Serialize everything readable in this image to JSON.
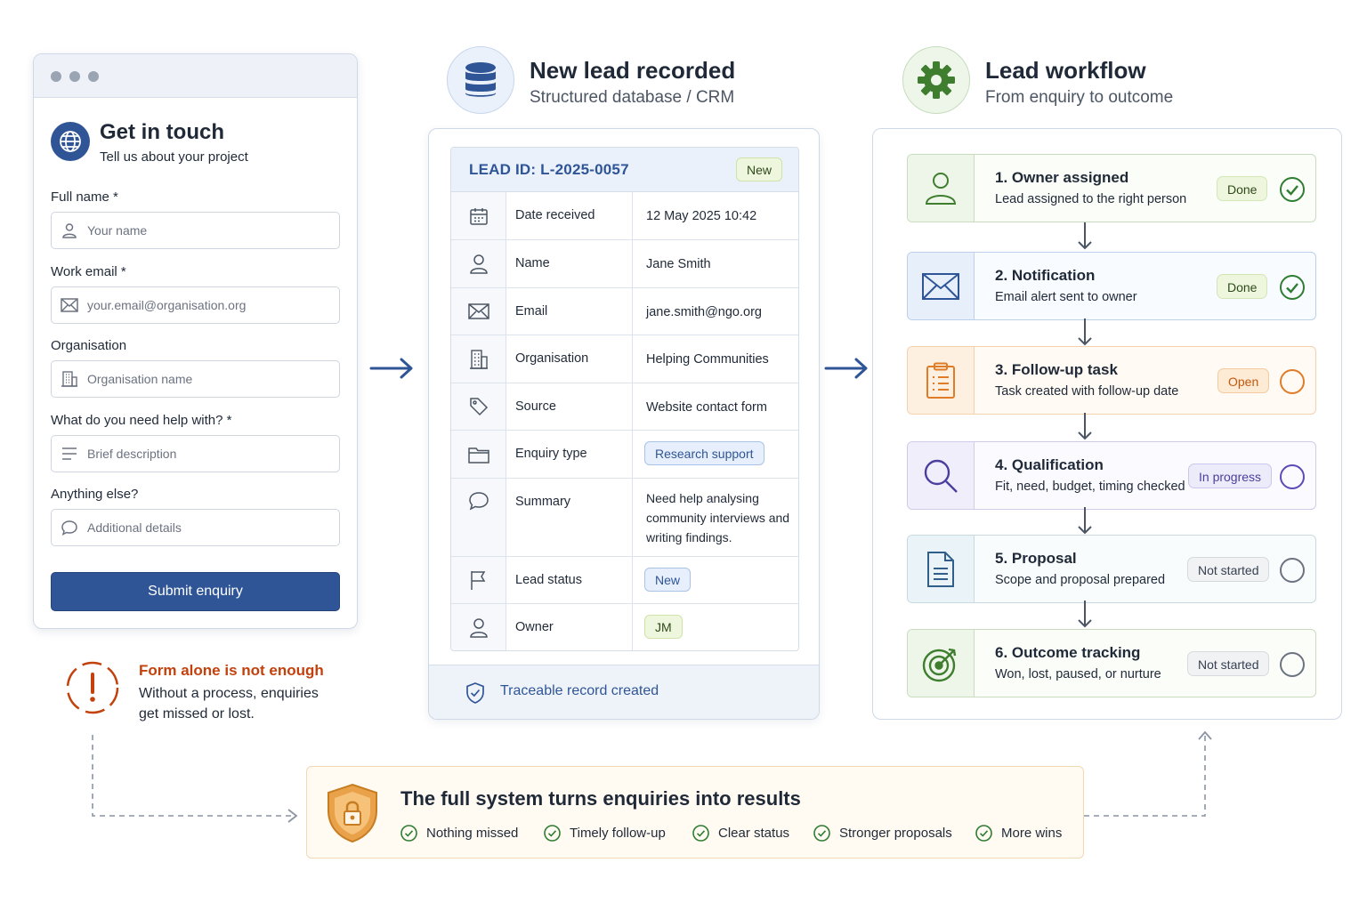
{
  "form": {
    "title": "Get in touch",
    "subtitle": "Tell us about your project",
    "fields": [
      {
        "label": "Full name *",
        "placeholder": "Your name",
        "icon": "user-icon"
      },
      {
        "label": "Work email *",
        "placeholder": "your.email@organisation.org",
        "icon": "envelope-icon"
      },
      {
        "label": "Organisation",
        "placeholder": "Organisation name",
        "icon": "building-icon"
      },
      {
        "label": "What do you need help with? *",
        "placeholder": "Brief description",
        "icon": "lines-icon"
      },
      {
        "label": "Anything else?",
        "placeholder": "Additional details",
        "icon": "chat-bubble-icon"
      }
    ],
    "submit_label": "Submit enquiry"
  },
  "warning": {
    "title": "Form alone is not enough",
    "text": "Without a process, enquiries get missed or lost."
  },
  "database": {
    "header_title": "New lead recorded",
    "header_subtitle": "Structured database / CRM",
    "lead_id": "LEAD ID: L-2025-0057",
    "lead_badge": "New",
    "rows": [
      {
        "label": "Date received",
        "value": "12 May 2025 10:42",
        "icon": "calendar-icon"
      },
      {
        "label": "Name",
        "value": "Jane Smith",
        "icon": "user-icon"
      },
      {
        "label": "Email",
        "value": "jane.smith@ngo.org",
        "icon": "envelope-icon"
      },
      {
        "label": "Organisation",
        "value": "Helping Communities",
        "icon": "building-icon"
      },
      {
        "label": "Source",
        "value": "Website contact form",
        "icon": "tag-icon"
      },
      {
        "label": "Enquiry type",
        "value": "Research support",
        "icon": "folder-icon"
      },
      {
        "label": "Summary",
        "value": "Need help analysing community interviews and writing findings.",
        "icon": "chat-bubble-icon"
      },
      {
        "label": "Lead status",
        "value": "New",
        "icon": "flag-icon"
      },
      {
        "label": "Owner",
        "value": "JM",
        "icon": "user-icon"
      }
    ],
    "footer_text": "Traceable record created"
  },
  "workflow": {
    "header_title": "Lead workflow",
    "header_subtitle": "From enquiry to outcome",
    "steps": [
      {
        "title": "1. Owner assigned",
        "desc": "Lead assigned to the right person",
        "status": "Done",
        "icon": "user-icon"
      },
      {
        "title": "2. Notification",
        "desc": "Email alert sent to owner",
        "status": "Done",
        "icon": "envelope-icon"
      },
      {
        "title": "3. Follow-up task",
        "desc": "Task created with follow-up date",
        "status": "Open",
        "icon": "clipboard-icon"
      },
      {
        "title": "4. Qualification",
        "desc": "Fit, need, budget, timing checked",
        "status": "In progress",
        "icon": "magnifier-icon"
      },
      {
        "title": "5. Proposal",
        "desc": "Scope and proposal prepared",
        "status": "Not started",
        "icon": "document-icon"
      },
      {
        "title": "6. Outcome tracking",
        "desc": "Won, lost, paused, or nurture",
        "status": "Not started",
        "icon": "target-icon"
      }
    ]
  },
  "banner": {
    "title": "The full system turns enquiries into results",
    "benefits": [
      "Nothing missed",
      "Timely follow-up",
      "Clear status",
      "Stronger proposals",
      "More wins"
    ]
  },
  "colors": {
    "primary_blue": "#2f5597",
    "done_green": "#2f7d32",
    "open_orange": "#e07b28",
    "progress_purple": "#5b4bb7",
    "neutral_gray": "#6b7280"
  }
}
